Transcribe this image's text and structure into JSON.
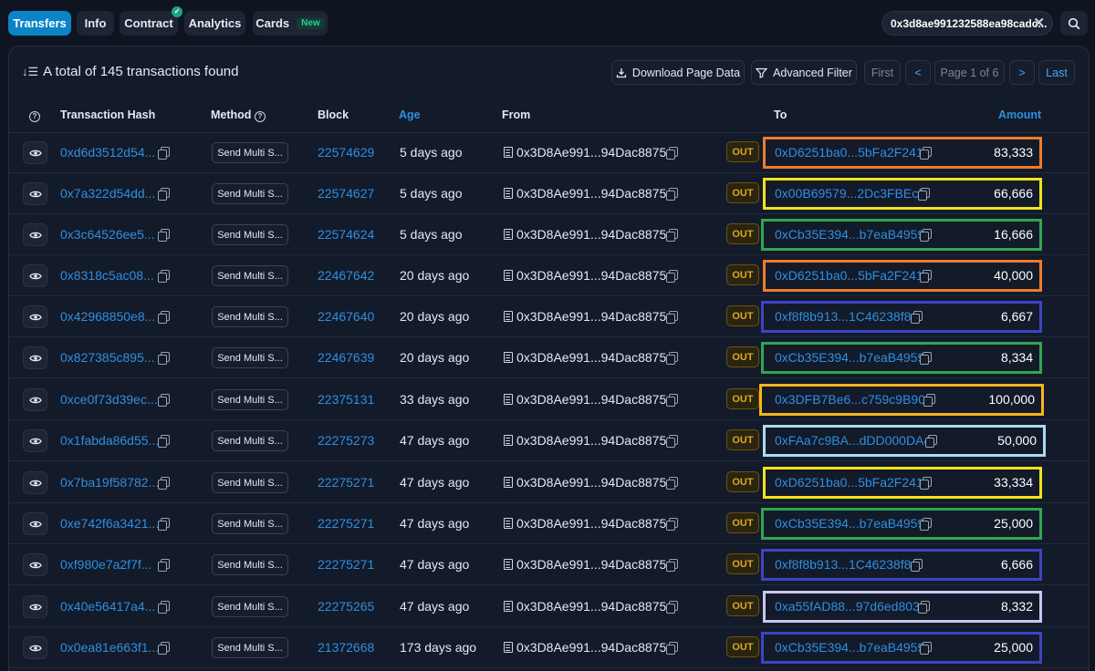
{
  "tabs": [
    {
      "label": "Transfers",
      "active": true
    },
    {
      "label": "Info"
    },
    {
      "label": "Contract",
      "verified": true
    },
    {
      "label": "Analytics"
    },
    {
      "label": "Cards",
      "badge": "New"
    }
  ],
  "address_filter": "0x3d8ae991232588ea98cadc...",
  "summary": "A total of 145 transactions found",
  "toolbar": {
    "download": "Download Page Data",
    "filter": "Advanced Filter",
    "first": "First",
    "prev": "<",
    "page": "Page 1 of 6",
    "next": ">",
    "last": "Last"
  },
  "columns": {
    "hash": "Transaction Hash",
    "method": "Method",
    "block": "Block",
    "age": "Age",
    "from": "From",
    "to": "To",
    "amount": "Amount"
  },
  "colors": {
    "orange": "#f07b2a",
    "yellow": "#f2e11c",
    "green": "#2fa84f",
    "navy": "#3d43c4",
    "lightblue": "#a9dcef",
    "gold": "#f6b41c",
    "lavender": "#c9c6ef"
  },
  "rows": [
    {
      "hash": "0xd6d3512d54...",
      "method": "Send Multi S...",
      "block": "22574629",
      "age": "5 days ago",
      "from": "0x3D8Ae991...94Dac8875",
      "dir": "OUT",
      "to": "0xD6251ba0...5bFa2F241",
      "amount": "83,333",
      "highlight": "orange"
    },
    {
      "hash": "0x7a322d54dd...",
      "method": "Send Multi S...",
      "block": "22574627",
      "age": "5 days ago",
      "from": "0x3D8Ae991...94Dac8875",
      "dir": "OUT",
      "to": "0x00B69579...2Dc3FBEcf",
      "amount": "66,666",
      "highlight": "yellow"
    },
    {
      "hash": "0x3c64526ee5...",
      "method": "Send Multi S...",
      "block": "22574624",
      "age": "5 days ago",
      "from": "0x3D8Ae991...94Dac8875",
      "dir": "OUT",
      "to": "0xCb35E394...b7eaB4959",
      "amount": "16,666",
      "highlight": "green"
    },
    {
      "hash": "0x8318c5ac08...",
      "method": "Send Multi S...",
      "block": "22467642",
      "age": "20 days ago",
      "from": "0x3D8Ae991...94Dac8875",
      "dir": "OUT",
      "to": "0xD6251ba0...5bFa2F241",
      "amount": "40,000",
      "highlight": "orange"
    },
    {
      "hash": "0x42968850e8...",
      "method": "Send Multi S...",
      "block": "22467640",
      "age": "20 days ago",
      "from": "0x3D8Ae991...94Dac8875",
      "dir": "OUT",
      "to": "0xf8f8b913...1C46238f8",
      "amount": "6,667",
      "highlight": "navy"
    },
    {
      "hash": "0x827385c895...",
      "method": "Send Multi S...",
      "block": "22467639",
      "age": "20 days ago",
      "from": "0x3D8Ae991...94Dac8875",
      "dir": "OUT",
      "to": "0xCb35E394...b7eaB4959",
      "amount": "8,334",
      "highlight": "green"
    },
    {
      "hash": "0xce0f73d39ec...",
      "method": "Send Multi S...",
      "block": "22375131",
      "age": "33 days ago",
      "from": "0x3D8Ae991...94Dac8875",
      "dir": "OUT",
      "to": "0x3DFB7Be6...c759c9B90",
      "amount": "100,000",
      "highlight": "gold"
    },
    {
      "hash": "0x1fabda86d55...",
      "method": "Send Multi S...",
      "block": "22275273",
      "age": "47 days ago",
      "from": "0x3D8Ae991...94Dac8875",
      "dir": "OUT",
      "to": "0xFAa7c9BA...dDD000DA4",
      "amount": "50,000",
      "highlight": "lightblue"
    },
    {
      "hash": "0x7ba19f58782...",
      "method": "Send Multi S...",
      "block": "22275271",
      "age": "47 days ago",
      "from": "0x3D8Ae991...94Dac8875",
      "dir": "OUT",
      "to": "0xD6251ba0...5bFa2F241",
      "amount": "33,334",
      "highlight": "yellow"
    },
    {
      "hash": "0xe742f6a3421...",
      "method": "Send Multi S...",
      "block": "22275271",
      "age": "47 days ago",
      "from": "0x3D8Ae991...94Dac8875",
      "dir": "OUT",
      "to": "0xCb35E394...b7eaB4959",
      "amount": "25,000",
      "highlight": "green"
    },
    {
      "hash": "0xf980e7a2f7f...",
      "method": "Send Multi S...",
      "block": "22275271",
      "age": "47 days ago",
      "from": "0x3D8Ae991...94Dac8875",
      "dir": "OUT",
      "to": "0xf8f8b913...1C46238f8",
      "amount": "6,666",
      "highlight": "navy"
    },
    {
      "hash": "0x40e56417a4...",
      "method": "Send Multi S...",
      "block": "22275265",
      "age": "47 days ago",
      "from": "0x3D8Ae991...94Dac8875",
      "dir": "OUT",
      "to": "0xa55fAD88...97d6ed803",
      "amount": "8,332",
      "highlight": "lavender"
    },
    {
      "hash": "0x0ea81e663f1...",
      "method": "Send Multi S...",
      "block": "21372668",
      "age": "173 days ago",
      "from": "0x3D8Ae991...94Dac8875",
      "dir": "OUT",
      "to": "0xCb35E394...b7eaB4959",
      "amount": "25,000",
      "highlight": "navy"
    }
  ]
}
